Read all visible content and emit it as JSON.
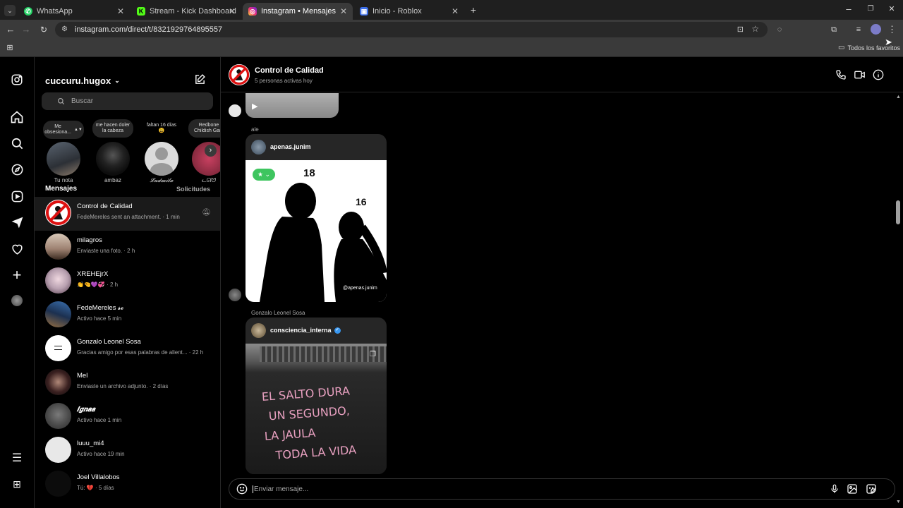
{
  "browser": {
    "tabs": [
      {
        "title": "WhatsApp",
        "icon": "whatsapp-icon"
      },
      {
        "title": "Stream - Kick Dashboard",
        "icon": "kick-icon"
      },
      {
        "title": "Instagram • Mensajes",
        "icon": "instagram-icon",
        "active": true
      },
      {
        "title": "Inicio - Roblox",
        "icon": "roblox-icon"
      }
    ],
    "url": "instagram.com/direct/t/8321929764895557",
    "bookmarks_label": "Todos los favoritos"
  },
  "inbox": {
    "username": "cuccuru.hugox",
    "search_placeholder": "Buscar",
    "notes": [
      {
        "note": "Me obsesiona...",
        "name": "Tu nota"
      },
      {
        "note": "me hacen doler la cabeza",
        "name": "ambaz"
      },
      {
        "note": "faltan 16 días 😩",
        "name": "𝓛𝓾𝓭𝓶𝓲𝓵𝓪"
      },
      {
        "note": "Redbone Childish Gam",
        "name": "ᓚᘏᗢ"
      }
    ],
    "section_title": "Mensajes",
    "requests_label": "Solicitudes",
    "conversations": [
      {
        "name": "Control de Calidad",
        "preview": "FedeMereles sent an attachment. · 1 min"
      },
      {
        "name": "milagros",
        "preview": "Enviaste una foto. · 2 h"
      },
      {
        "name": "XREHEjrX",
        "preview": "👏🤏💜💞 · 2 h"
      },
      {
        "name": "FedeMereles 𝓼𝓮",
        "preview": "Activo hace 5 min"
      },
      {
        "name": "Gonzalo Leonel Sosa",
        "preview": "Gracias amigo por esas palabras de alient... · 22 h"
      },
      {
        "name": "Mel",
        "preview": "Enviaste un archivo adjunto. · 2 días"
      },
      {
        "name": "𝑰𝒈𝒏𝒂𝒂",
        "preview": "Activo hace 1 min"
      },
      {
        "name": "luuu_mi4",
        "preview": "Activo hace 19 min"
      },
      {
        "name": "Joel Villalobos",
        "preview": "Tú: 💔 · 5 días"
      }
    ]
  },
  "chat": {
    "title": "Control de Calidad",
    "subtitle": "5 personas activas hoy",
    "messages": [
      {
        "sender": "ale",
        "post_author": "apenas.junim",
        "watermark": "@apenas.junim",
        "n1": "18",
        "n2": "16"
      },
      {
        "sender": "Gonzalo Leonel Sosa",
        "post_author": "consciencia_interna",
        "graffiti": [
          "EL SALTO DURA",
          "UN SEGUNDO,",
          "LA JAULA",
          "TODA LA VIDA"
        ]
      }
    ],
    "input_placeholder": "Enviar mensaje..."
  }
}
